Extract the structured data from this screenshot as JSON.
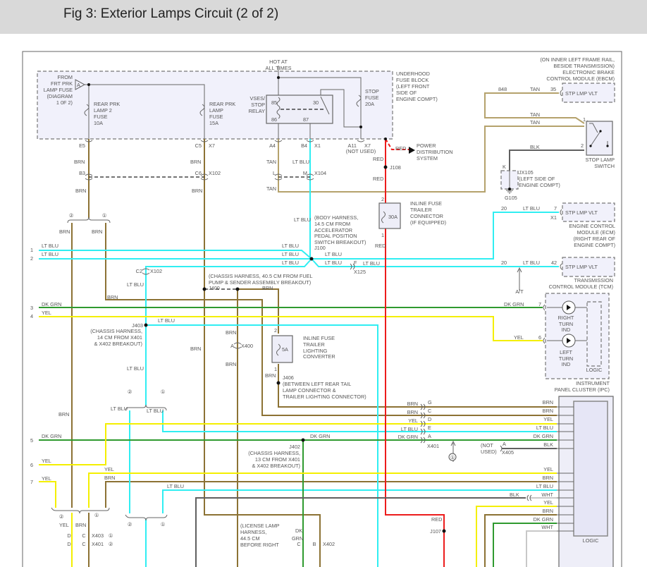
{
  "header": {
    "title": "Fig 3: Exterior Lamps Circuit (2 of 2)"
  },
  "colors": {
    "brn": "#8c7234",
    "tan": "#b5a26c",
    "lt_blu": "#30eef2",
    "dk_grn": "#2f9a2f",
    "yel": "#f4ef00",
    "red": "#ec1c1c",
    "blk": "#606060",
    "wht": "#c8c8c8",
    "header_bg": "#d9d9d9"
  },
  "fuse_block": {
    "title": [
      "UNDERHOOD",
      "FUSE BLOCK",
      "(LEFT FRONT",
      "SIDE OF",
      "ENGINE COMPT)"
    ],
    "hot_at": [
      "HOT AT",
      "ALL TIMES"
    ],
    "from_note": [
      "FROM",
      "FRT PRK",
      "LAMP FUSE",
      "(DIAGRAM",
      "1 0F 2)"
    ],
    "from_tag": "A",
    "rear_prk_lamp2_fuse": [
      "REAR PRK",
      "LAMP 2",
      "FUSE",
      "10A"
    ],
    "rear_prk_lamp_fuse": [
      "REAR PRK",
      "LAMP",
      "FUSE",
      "15A"
    ],
    "relay": [
      "VSES/",
      "STOP",
      "RELAY"
    ],
    "relay_pins": [
      "85",
      "86",
      "30",
      "87"
    ],
    "stop_fuse": [
      "STOP",
      "FUSE",
      "20A"
    ]
  },
  "connectors": {
    "e5": "E5",
    "c5": "C5",
    "x7": "X7",
    "a4": "A4",
    "b4": "B4",
    "x1": "X1",
    "a11": "A11",
    "x7b": "X7",
    "not_used": "(NOT USED)",
    "b3": "B3",
    "c6": "C6",
    "x102": "X102",
    "l": "L",
    "m": "M",
    "x104": "X104",
    "c2": "C2",
    "x102b": "X102",
    "f": "F",
    "x125": "X125",
    "a": "A",
    "x400": "X400",
    "x401_pins": [
      "G",
      "C",
      "D",
      "E",
      "A"
    ],
    "x401": "X401",
    "x405_pin": "A",
    "x405": "X405",
    "x405_note": [
      "(NOT",
      "USED)"
    ],
    "x403_row": [
      "D",
      "C",
      "X403"
    ],
    "x401_row": [
      "D",
      "C",
      "X401"
    ],
    "x402": [
      "C",
      "B",
      "X402"
    ]
  },
  "stop_lamp_switch": {
    "name": [
      "STOP LAMP",
      "SWITCH"
    ],
    "pins": [
      "1",
      "2"
    ]
  },
  "ebcm": {
    "location": [
      "(ON INNER LEFT FRAME RAIL,",
      "BESIDE TRANSMISSION)"
    ],
    "name": [
      "ELECTRONIC BRAKE",
      "CONTROL MODULE (EBCM)"
    ],
    "terminal": "STP LMP VLT",
    "circuit": "848",
    "pin": "35"
  },
  "ground": {
    "connector": "K",
    "splice_pack": [
      "JX105",
      "(LEFT SIDE OF",
      "ENGINE COMPT)"
    ],
    "ground": "G105"
  },
  "ecm": {
    "terminal": "STP LMP VLT",
    "circuit": "20",
    "pin": "7",
    "connector": "X1",
    "name": [
      "ENGINE CONTROL",
      "MODULE (ECM)",
      "(RIGHT REAR OF",
      "ENGINE COMPT)"
    ]
  },
  "tcm": {
    "terminal": "STP LMP VLT",
    "circuit": "20",
    "pin": "42",
    "name": [
      "TRANSMISSION",
      "CONTROL MODULE (TCM)"
    ],
    "option": "A/T"
  },
  "ipc": {
    "pin_right": "7",
    "pin_left": "6",
    "right_ind": [
      "RIGHT",
      "TURN",
      "IND"
    ],
    "left_ind": [
      "LEFT",
      "TURN",
      "IND"
    ],
    "logic": "LOGIC",
    "name": [
      "INSTRUMENT",
      "PANEL CLUSTER (IPC)"
    ],
    "logic2": "LOGIC"
  },
  "power": {
    "name": [
      "POWER",
      "DISTRIBUTION",
      "SYSTEM"
    ]
  },
  "trailer_fuse_30a": {
    "pins": [
      "2",
      "1"
    ],
    "rating": "30A",
    "name": [
      "INLINE FUSE",
      "TRAILER",
      "CONNECTOR",
      "(IF EQUIPPED)"
    ]
  },
  "trailer_fuse_5a": {
    "pins": [
      "2",
      "1"
    ],
    "rating": "5A",
    "name": [
      "INLINE FUSE",
      "TRAILER",
      "LIGHTING",
      "CONVERTER"
    ]
  },
  "splices": {
    "j108": "J108",
    "j100": [
      "(BODY HARNESS,",
      "14.5 CM FROM",
      "ACCELERATOR",
      "PEDAL POSITION",
      "SWITCH BREAKOUT)",
      "J100"
    ],
    "j400": "J400",
    "j400_note": [
      "(CHASSIS HARNESS, 40.5 CM FROM FUEL",
      "PUMP & SENDER ASSEMBLY BREAKOUT)"
    ],
    "j403": "J403",
    "j403_note": [
      "(CHASSIS HARNESS,",
      "14 CM FROM X401",
      "& X402 BREAKOUT)"
    ],
    "j406": "J406",
    "j406_note": [
      "(BETWEEN LEFT REAR TAIL",
      "LAMP CONNECTOR &",
      "TRAILER LIGHTING CONNECTOR)"
    ],
    "j402": "J402",
    "j402_note": [
      "(CHASSIS HARNESS,",
      "13 CM FROM X401",
      "& X402 BREAKOUT)"
    ],
    "j107": "J107",
    "license": [
      "(LICENSE LAMP",
      "HARNESS,",
      "44.5 CM",
      "BEFORE RIGHT"
    ]
  },
  "line_numbers": [
    "1",
    "2",
    "3",
    "4",
    "5",
    "6",
    "7"
  ],
  "markers": [
    "①",
    "②"
  ],
  "wire_labels": [
    "BRN",
    "TAN",
    "LT BLU",
    "RED",
    "BLK",
    "DK GRN",
    "YEL",
    "WHT",
    "DK",
    "GRN"
  ]
}
